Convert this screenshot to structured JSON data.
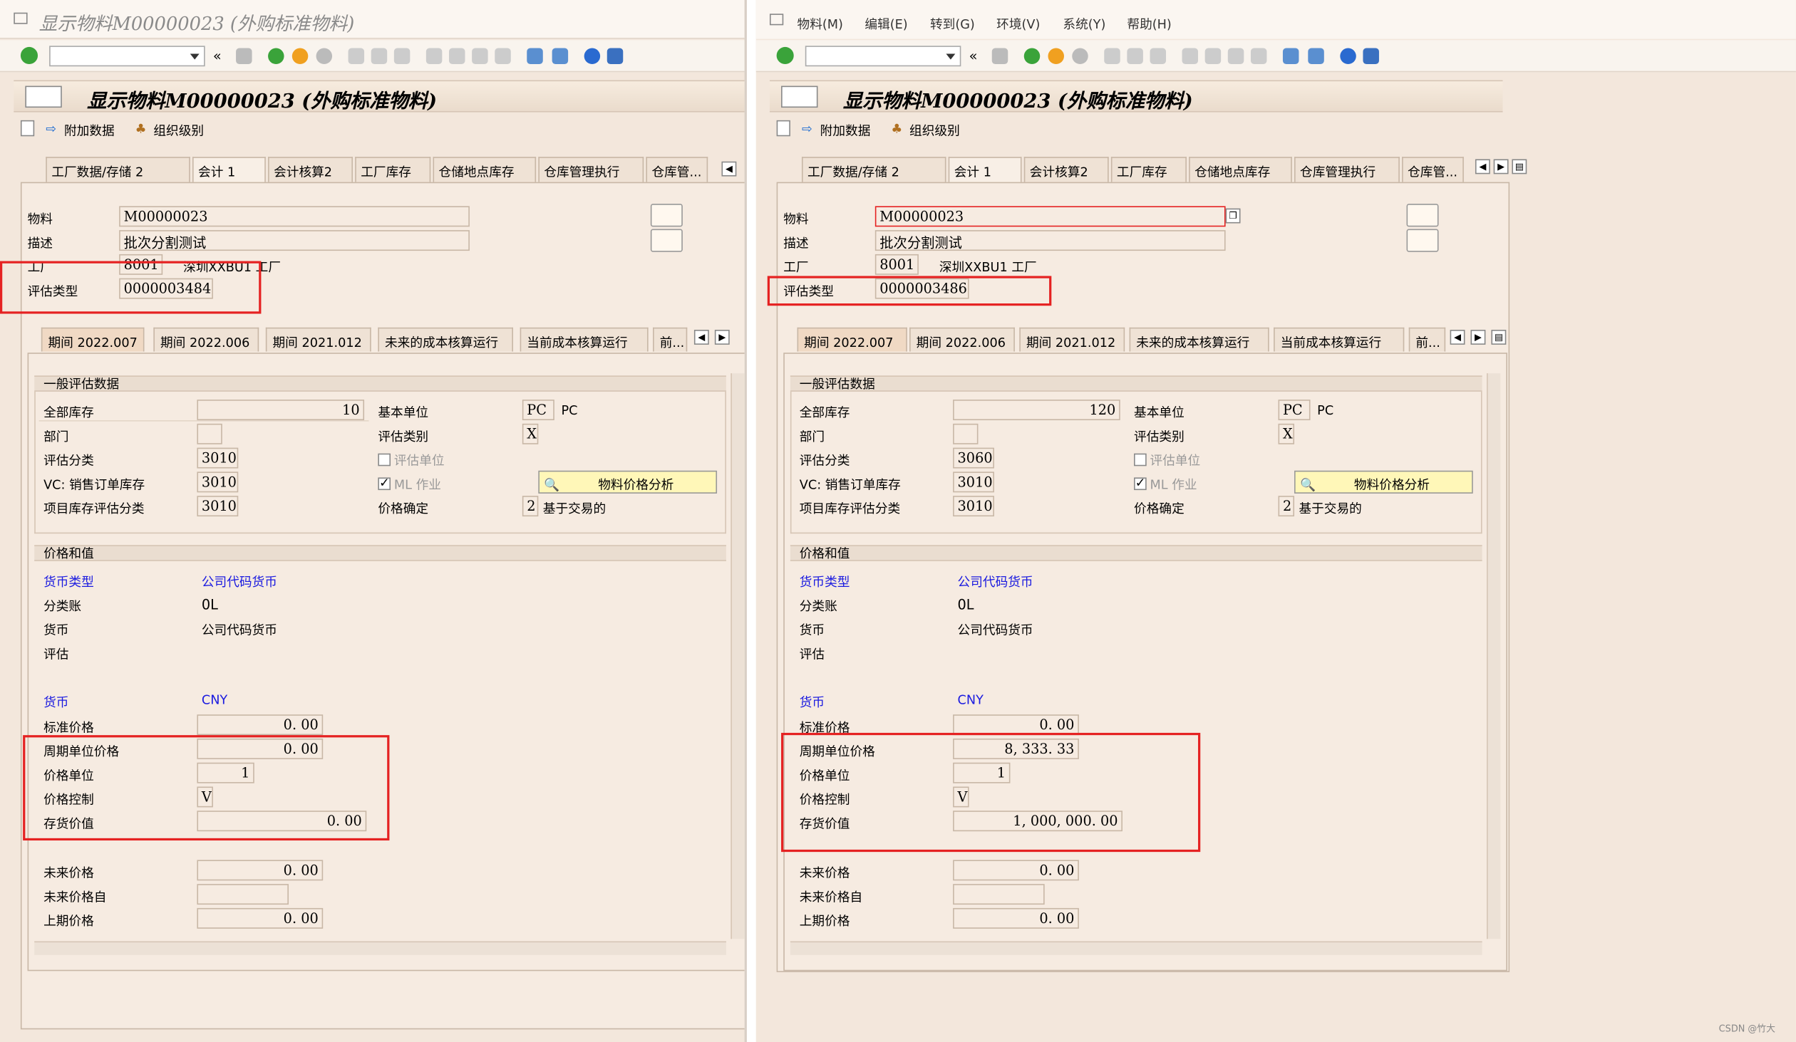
{
  "left": {
    "window_title": "显示物料M00000023 (外购标准物料)",
    "header_title": "显示物料M00000023 (外购标准物料)",
    "app_toolbar": {
      "additional_data": "附加数据",
      "org_levels": "组织级别"
    },
    "tabs": [
      "工厂数据/存储 2",
      "会计 1",
      "会计核算2",
      "工厂库存",
      "仓储地点库存",
      "仓库管理执行",
      "仓库管..."
    ],
    "material_label": "物料",
    "material_value": "M00000023",
    "desc_label": "描述",
    "desc_value": "批次分割测试",
    "plant_label": "工厂",
    "plant_value": "8001",
    "plant_name": "深圳XXBU1 工厂",
    "val_type_label": "评估类型",
    "val_type_value": "0000003484",
    "periods": [
      "期间 2022.007",
      "期间 2022.006",
      "期间 2021.012",
      "未来的成本核算运行",
      "当前成本核算运行",
      "前..."
    ],
    "general": {
      "title": "一般评估数据",
      "total_stock_label": "全部库存",
      "total_stock": "10",
      "base_unit_label": "基本单位",
      "base_unit": "PC",
      "base_unit_text": "PC",
      "division_label": "部门",
      "val_cat_label": "评估类别",
      "val_cat": "X",
      "val_class_label": "评估分类",
      "val_class": "3010",
      "val_unit_label": "评估单位",
      "vc_label": "VC: 销售订单库存",
      "vc_value": "3010",
      "ml_label": "ML 作业",
      "price_analysis": "物料价格分析",
      "proj_label": "项目库存评估分类",
      "proj_value": "3010",
      "price_det_label": "价格确定",
      "price_det": "2",
      "price_det_text": "基于交易的"
    },
    "prices": {
      "title": "价格和值",
      "currency_type_label": "货币类型",
      "currency_type": "公司代码货币",
      "ledger_label": "分类账",
      "ledger": "0L",
      "currency_label1": "货币",
      "currency1": "公司代码货币",
      "valuation_label": "评估",
      "currency_label2": "货币",
      "currency2": "CNY",
      "std_price_label": "标准价格",
      "std_price": "0. 00",
      "period_price_label": "周期单位价格",
      "period_price": "0. 00",
      "price_unit_label": "价格单位",
      "price_unit": "1",
      "price_ctrl_label": "价格控制",
      "price_ctrl": "V",
      "inv_value_label": "存货价值",
      "inv_value": "0. 00",
      "future_price_label": "未来价格",
      "future_price": "0. 00",
      "future_from_label": "未来价格自",
      "prev_price_label": "上期价格",
      "prev_price": "0. 00"
    }
  },
  "right": {
    "menu": [
      "物料(M)",
      "编辑(E)",
      "转到(G)",
      "环境(V)",
      "系统(Y)",
      "帮助(H)"
    ],
    "header_title": "显示物料M00000023 (外购标准物料)",
    "app_toolbar": {
      "additional_data": "附加数据",
      "org_levels": "组织级别"
    },
    "tabs": [
      "工厂数据/存储 2",
      "会计 1",
      "会计核算2",
      "工厂库存",
      "仓储地点库存",
      "仓库管理执行",
      "仓库管..."
    ],
    "material_label": "物料",
    "material_value": "M00000023",
    "desc_label": "描述",
    "desc_value": "批次分割测试",
    "plant_label": "工厂",
    "plant_value": "8001",
    "plant_name": "深圳XXBU1 工厂",
    "val_type_label": "评估类型",
    "val_type_value": "0000003486",
    "periods": [
      "期间 2022.007",
      "期间 2022.006",
      "期间 2021.012",
      "未来的成本核算运行",
      "当前成本核算运行",
      "前..."
    ],
    "general": {
      "title": "一般评估数据",
      "total_stock_label": "全部库存",
      "total_stock": "120",
      "base_unit_label": "基本单位",
      "base_unit": "PC",
      "base_unit_text": "PC",
      "division_label": "部门",
      "val_cat_label": "评估类别",
      "val_cat": "X",
      "val_class_label": "评估分类",
      "val_class": "3060",
      "val_unit_label": "评估单位",
      "vc_label": "VC: 销售订单库存",
      "vc_value": "3010",
      "ml_label": "ML 作业",
      "price_analysis": "物料价格分析",
      "proj_label": "项目库存评估分类",
      "proj_value": "3010",
      "price_det_label": "价格确定",
      "price_det": "2",
      "price_det_text": "基于交易的"
    },
    "prices": {
      "title": "价格和值",
      "currency_type_label": "货币类型",
      "currency_type": "公司代码货币",
      "ledger_label": "分类账",
      "ledger": "0L",
      "currency_label1": "货币",
      "currency1": "公司代码货币",
      "valuation_label": "评估",
      "currency_label2": "货币",
      "currency2": "CNY",
      "std_price_label": "标准价格",
      "std_price": "0. 00",
      "period_price_label": "周期单位价格",
      "period_price": "8, 333. 33",
      "price_unit_label": "价格单位",
      "price_unit": "1",
      "price_ctrl_label": "价格控制",
      "price_ctrl": "V",
      "inv_value_label": "存货价值",
      "inv_value": "1, 000, 000. 00",
      "future_price_label": "未来价格",
      "future_price": "0. 00",
      "future_from_label": "未来价格自",
      "prev_price_label": "上期价格",
      "prev_price": "0. 00"
    }
  },
  "watermark": "CSDN @竹大",
  "colors": {
    "highlight": "#e52222",
    "link": "#1a1ae0",
    "ok": "#3aa33a"
  }
}
